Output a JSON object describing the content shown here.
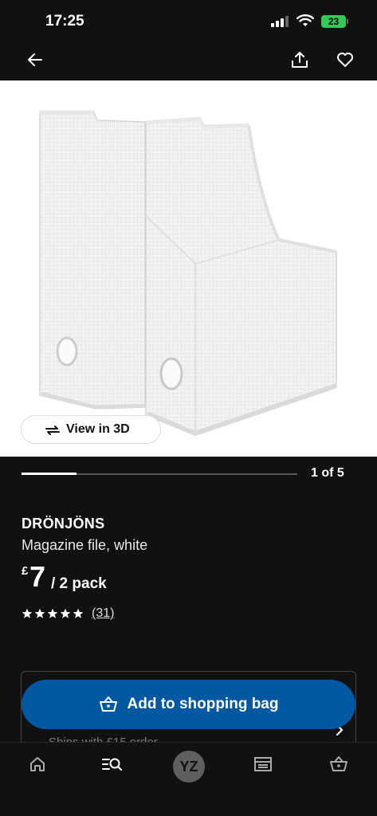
{
  "status_bar": {
    "time": "17:25",
    "battery": "23"
  },
  "top_nav": {
    "back_icon": "arrow-left-icon",
    "share_icon": "share-icon",
    "favorite_icon": "heart-icon"
  },
  "gallery": {
    "view_3d_label": "View in 3D",
    "counter": "1 of 5",
    "progress": 0.2
  },
  "product": {
    "name": "DRÖNJÖNS",
    "description": "Magazine file, white",
    "currency": "£",
    "price": "7",
    "unit": "/ 2 pack",
    "rating": 5,
    "review_count": "(31)"
  },
  "shipping": {
    "text": "Ships with £15 order"
  },
  "cta": {
    "add_to_bag_label": "Add to shopping bag"
  },
  "tab_bar": {
    "items": [
      "home-icon",
      "search-list-icon",
      "avatar",
      "store-icon",
      "basket-icon"
    ],
    "avatar_initials": "YZ"
  },
  "colors": {
    "accent": "#0058a3",
    "background": "#111111",
    "battery": "#34c759"
  }
}
